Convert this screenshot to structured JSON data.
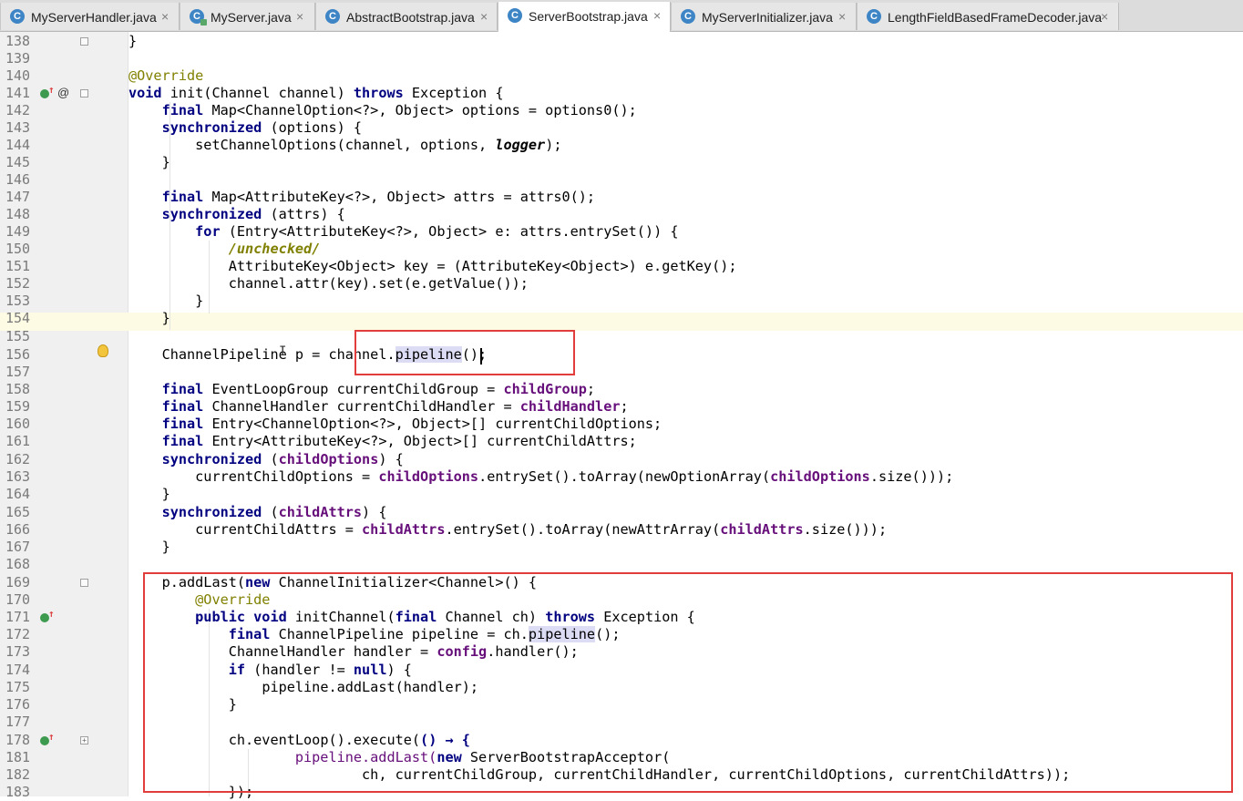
{
  "tabs": [
    {
      "label": "MyServerHandler.java",
      "icon": "class-icon",
      "active": false
    },
    {
      "label": "MyServer.java",
      "icon": "class-run-icon",
      "active": false
    },
    {
      "label": "AbstractBootstrap.java",
      "icon": "class-icon",
      "active": false
    },
    {
      "label": "ServerBootstrap.java",
      "icon": "class-icon",
      "active": true
    },
    {
      "label": "MyServerInitializer.java",
      "icon": "class-icon",
      "active": false
    },
    {
      "label": "LengthFieldBasedFrameDecoder.java",
      "icon": "class-icon",
      "active": false
    }
  ],
  "tab_close_glyph": "×",
  "class_icon_letter": "C",
  "line_numbers": [
    "138",
    "139",
    "140",
    "141",
    "142",
    "143",
    "144",
    "145",
    "146",
    "147",
    "148",
    "149",
    "150",
    "151",
    "152",
    "153",
    "154",
    "155",
    "156",
    "157",
    "158",
    "159",
    "160",
    "161",
    "162",
    "163",
    "164",
    "165",
    "166",
    "167",
    "168",
    "169",
    "170",
    "171",
    "172",
    "173",
    "174",
    "175",
    "176",
    "177",
    "178",
    "181",
    "182",
    "183"
  ],
  "code": {
    "l138": "}",
    "l140": "@Override",
    "l141_kw1": "void",
    "l141_a": " init(Channel channel) ",
    "l141_kw2": "throws",
    "l141_b": " Exception {",
    "l142_kw": "final",
    "l142_a": " Map<ChannelOption<?>, Object> options = options0();",
    "l143_kw": "synchronized",
    "l143_a": " (options) {",
    "l144_a": "setChannelOptions(channel, options, ",
    "l144_it": "logger",
    "l144_b": ");",
    "l145": "}",
    "l147_kw": "final",
    "l147_a": " Map<AttributeKey<?>, Object> attrs = attrs0();",
    "l148_kw": "synchronized",
    "l148_a": " (attrs) {",
    "l149_kw": "for",
    "l149_a": " (Entry<AttributeKey<?>, Object> e: attrs.entrySet()) {",
    "l150": "/unchecked/",
    "l151": "AttributeKey<Object> key = (AttributeKey<Object>) e.getKey();",
    "l152": "channel.attr(key).set(e.getValue());",
    "l153": "}",
    "l154": "}",
    "l156_a": "ChannelPipeline p = channel.",
    "l156_hl": "pipeline",
    "l156_b": "();",
    "l158_kw": "final",
    "l158_a": " EventLoopGroup currentChildGroup = ",
    "l158_f": "childGroup",
    "l158_b": ";",
    "l159_kw": "final",
    "l159_a": " ChannelHandler currentChildHandler = ",
    "l159_f": "childHandler",
    "l159_b": ";",
    "l160_kw": "final",
    "l160_a": " Entry<ChannelOption<?>, Object>[] currentChildOptions;",
    "l161_kw": "final",
    "l161_a": " Entry<AttributeKey<?>, Object>[] currentChildAttrs;",
    "l162_kw": "synchronized",
    "l162_a": " (",
    "l162_f": "childOptions",
    "l162_b": ") {",
    "l163_a": "currentChildOptions = ",
    "l163_f1": "childOptions",
    "l163_b": ".entrySet().toArray(newOptionArray(",
    "l163_f2": "childOptions",
    "l163_c": ".size()));",
    "l164": "}",
    "l165_kw": "synchronized",
    "l165_a": " (",
    "l165_f": "childAttrs",
    "l165_b": ") {",
    "l166_a": "currentChildAttrs = ",
    "l166_f1": "childAttrs",
    "l166_b": ".entrySet().toArray(newAttrArray(",
    "l166_f2": "childAttrs",
    "l166_c": ".size()));",
    "l167": "}",
    "l169_a": "p.addLast(",
    "l169_kw": "new",
    "l169_b": " ChannelInitializer<Channel>() {",
    "l170": "@Override",
    "l171_kw1": "public void",
    "l171_a": " initChannel(",
    "l171_kw2": "final",
    "l171_b": " Channel ch) ",
    "l171_kw3": "throws",
    "l171_c": " Exception {",
    "l172_kw": "final",
    "l172_a": " ChannelPipeline pipeline = ch.",
    "l172_hl": "pipeline",
    "l172_b": "();",
    "l173_a": "ChannelHandler handler = ",
    "l173_f": "config",
    "l173_b": ".handler();",
    "l174_kw1": "if",
    "l174_a": " (handler != ",
    "l174_kw2": "null",
    "l174_b": ") {",
    "l175": "pipeline.addLast(handler);",
    "l176": "}",
    "l178_a": "ch.eventLoop().execute(",
    "l178_b": "() → {",
    "l181_a": "pipeline.addLast(",
    "l181_kw": "new",
    "l181_b": " ServerBootstrapAcceptor(",
    "l182": "ch, currentChildGroup, currentChildHandler, currentChildOptions, currentChildAttrs));",
    "l183": "});"
  },
  "colors": {
    "keyword": "#000080",
    "annotation": "#808000",
    "field": "#660e7a",
    "highlight_box": "#e23d3d",
    "current_line": "#fdfbe4"
  }
}
